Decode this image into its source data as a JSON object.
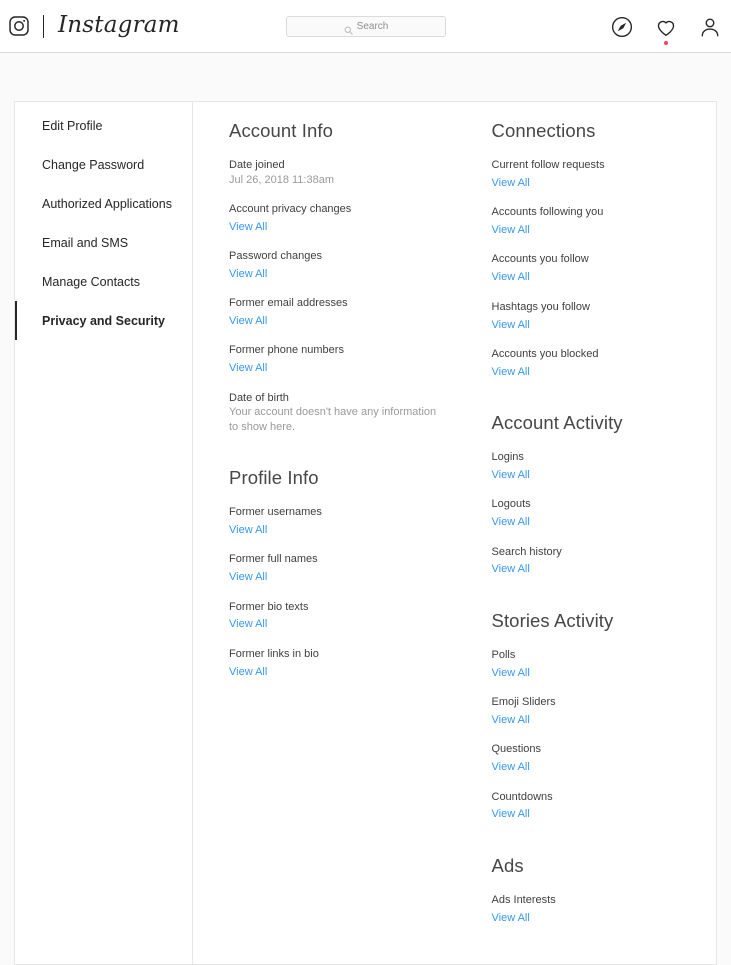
{
  "header": {
    "brand_name": "Instagram",
    "logo_icon": "instagram-camera-icon",
    "search": {
      "placeholder": "Search",
      "value": "",
      "icon": "search-icon"
    },
    "nav": [
      {
        "icon": "explore-compass-icon",
        "label": "Explore",
        "has_badge": false
      },
      {
        "icon": "heart-activity-icon",
        "label": "Activity",
        "has_badge": true
      },
      {
        "icon": "profile-person-icon",
        "label": "Profile",
        "has_badge": false
      }
    ],
    "badge_color": "#ed4956"
  },
  "sidebar": {
    "items": [
      {
        "label": "Edit Profile",
        "active": false
      },
      {
        "label": "Change Password",
        "active": false
      },
      {
        "label": "Authorized Applications",
        "active": false
      },
      {
        "label": "Email and SMS",
        "active": false
      },
      {
        "label": "Manage Contacts",
        "active": false
      },
      {
        "label": "Privacy and Security",
        "active": true
      }
    ]
  },
  "link_color": "#3897f0",
  "view_all_label": "View All",
  "content": {
    "left_column": [
      {
        "title": "Account Info",
        "entries": [
          {
            "label": "Date joined",
            "value": "Jul 26, 2018 11:38am",
            "link": null
          },
          {
            "label": "Account privacy changes",
            "value": null,
            "link": "View All"
          },
          {
            "label": "Password changes",
            "value": null,
            "link": "View All"
          },
          {
            "label": "Former email addresses",
            "value": null,
            "link": "View All"
          },
          {
            "label": "Former phone numbers",
            "value": null,
            "link": "View All"
          },
          {
            "label": "Date of birth",
            "value": "Your account doesn't have any information to show here.",
            "link": null
          }
        ]
      },
      {
        "title": "Profile Info",
        "entries": [
          {
            "label": "Former usernames",
            "value": null,
            "link": "View All"
          },
          {
            "label": "Former full names",
            "value": null,
            "link": "View All"
          },
          {
            "label": "Former bio texts",
            "value": null,
            "link": "View All"
          },
          {
            "label": "Former links in bio",
            "value": null,
            "link": "View All"
          }
        ]
      }
    ],
    "right_column": [
      {
        "title": "Connections",
        "entries": [
          {
            "label": "Current follow requests",
            "value": null,
            "link": "View All"
          },
          {
            "label": "Accounts following you",
            "value": null,
            "link": "View All"
          },
          {
            "label": "Accounts you follow",
            "value": null,
            "link": "View All"
          },
          {
            "label": "Hashtags you follow",
            "value": null,
            "link": "View All"
          },
          {
            "label": "Accounts you blocked",
            "value": null,
            "link": "View All"
          }
        ]
      },
      {
        "title": "Account Activity",
        "entries": [
          {
            "label": "Logins",
            "value": null,
            "link": "View All"
          },
          {
            "label": "Logouts",
            "value": null,
            "link": "View All"
          },
          {
            "label": "Search history",
            "value": null,
            "link": "View All"
          }
        ]
      },
      {
        "title": "Stories Activity",
        "entries": [
          {
            "label": "Polls",
            "value": null,
            "link": "View All"
          },
          {
            "label": "Emoji Sliders",
            "value": null,
            "link": "View All"
          },
          {
            "label": "Questions",
            "value": null,
            "link": "View All"
          },
          {
            "label": "Countdowns",
            "value": null,
            "link": "View All"
          }
        ]
      },
      {
        "title": "Ads",
        "entries": [
          {
            "label": "Ads Interests",
            "value": null,
            "link": "View All"
          }
        ]
      }
    ]
  }
}
